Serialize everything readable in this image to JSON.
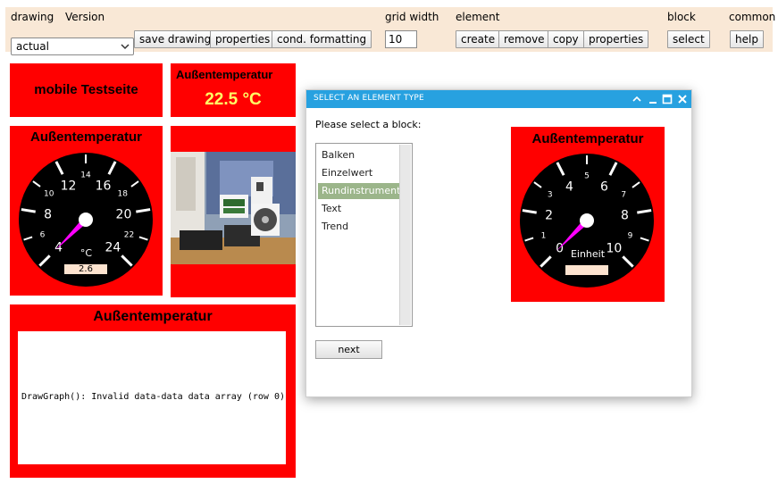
{
  "toolbar": {
    "drawing_label": "drawing",
    "version_label": "Version",
    "version_value": "actual",
    "save_drawing": "save drawing",
    "drawing_properties": "properties",
    "cond_formatting": "cond. formatting",
    "grid_width_label": "grid width",
    "grid_width_value": "10",
    "element_label": "element",
    "create": "create",
    "remove": "remove",
    "copy": "copy",
    "element_properties": "properties",
    "block_label": "block",
    "select": "select",
    "common_label": "common",
    "help": "help"
  },
  "widgets": {
    "title_text": "mobile Testseite",
    "value_title": "Außentemperatur",
    "value_text": "22.5 °C",
    "gauge_title": "Außentemperatur",
    "gauge_unit": "°C",
    "gauge_value": "2.6",
    "gauge_value_num": 2.6,
    "gauge_major": [
      "4",
      "8",
      "12",
      "16",
      "20",
      "24"
    ],
    "gauge_minor": [
      "6",
      "10",
      "14",
      "18",
      "22"
    ],
    "graph_title": "Außentemperatur",
    "graph_error": "DrawGraph(): Invalid data-data data array (row 0)"
  },
  "dialog": {
    "title": "SELECT AN ELEMENT TYPE",
    "prompt": "Please select a block:",
    "items": [
      "Balken",
      "Einzelwert",
      "Rundinstrument",
      "Text",
      "Trend"
    ],
    "selected": "Rundinstrument",
    "next": "next",
    "preview_title": "Außentemperatur",
    "preview_unit": "Einheit",
    "preview_major": [
      "0",
      "2",
      "4",
      "6",
      "8",
      "10"
    ],
    "preview_minor": [
      "1",
      "3",
      "5",
      "7",
      "9"
    ]
  },
  "colors": {
    "panel_red": "#ff0000",
    "value_yellow": "#ffff66",
    "titlebar_blue": "#27a1e0",
    "needle_magenta": "#ff00ff",
    "toolbar_bg": "#f9e8d6"
  }
}
